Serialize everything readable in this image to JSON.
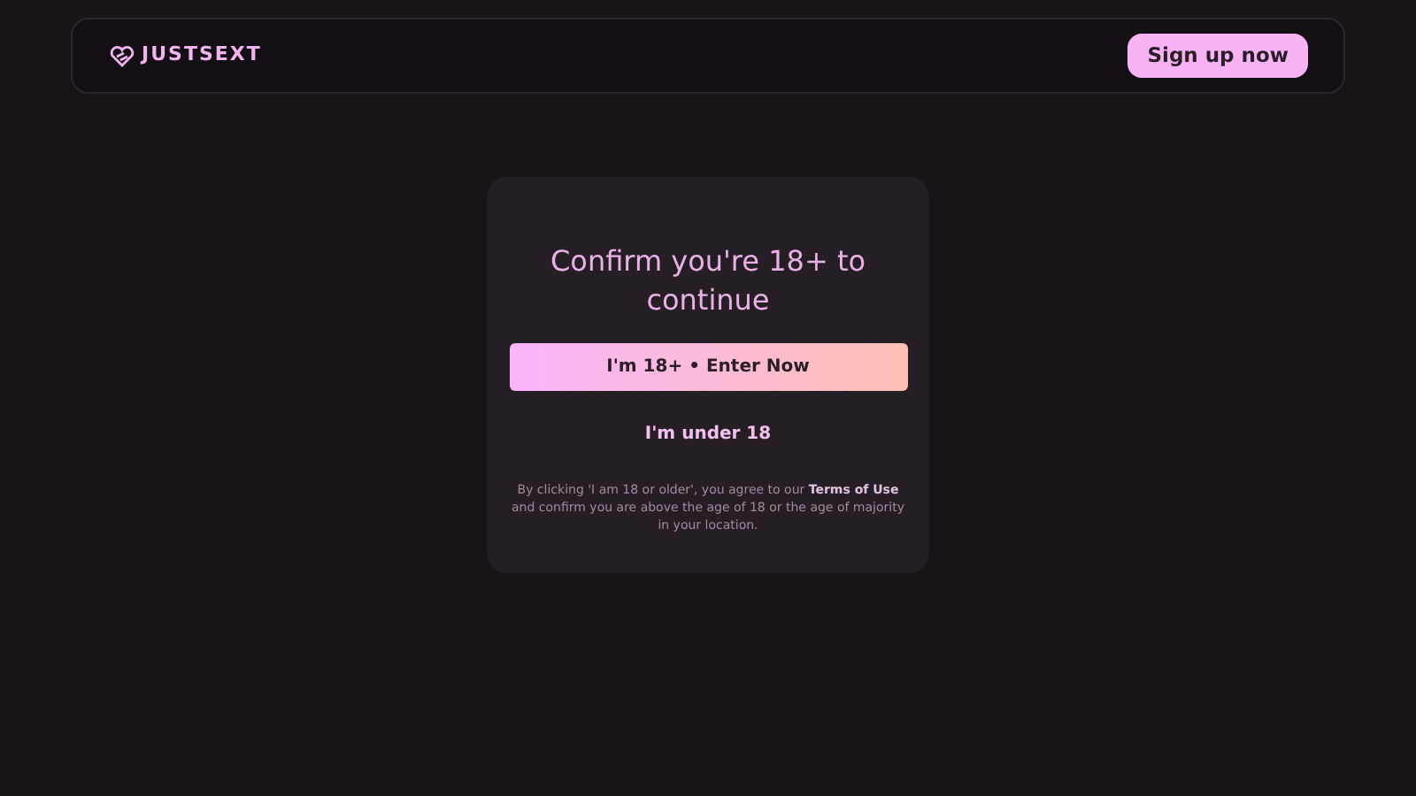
{
  "header": {
    "logo_text": "JUSTSEXT",
    "signup_button": "Sign up now"
  },
  "age_gate": {
    "title": "Confirm you're 18+ to continue",
    "confirm_button": "I'm 18+ • Enter Now",
    "decline_link": "I'm under 18",
    "disclaimer": {
      "before": "By clicking 'I am 18 or older', you agree to our",
      "link": "Terms of Use",
      "after": "and confirm you are above the age of 18 or the age of majority in your location."
    }
  }
}
